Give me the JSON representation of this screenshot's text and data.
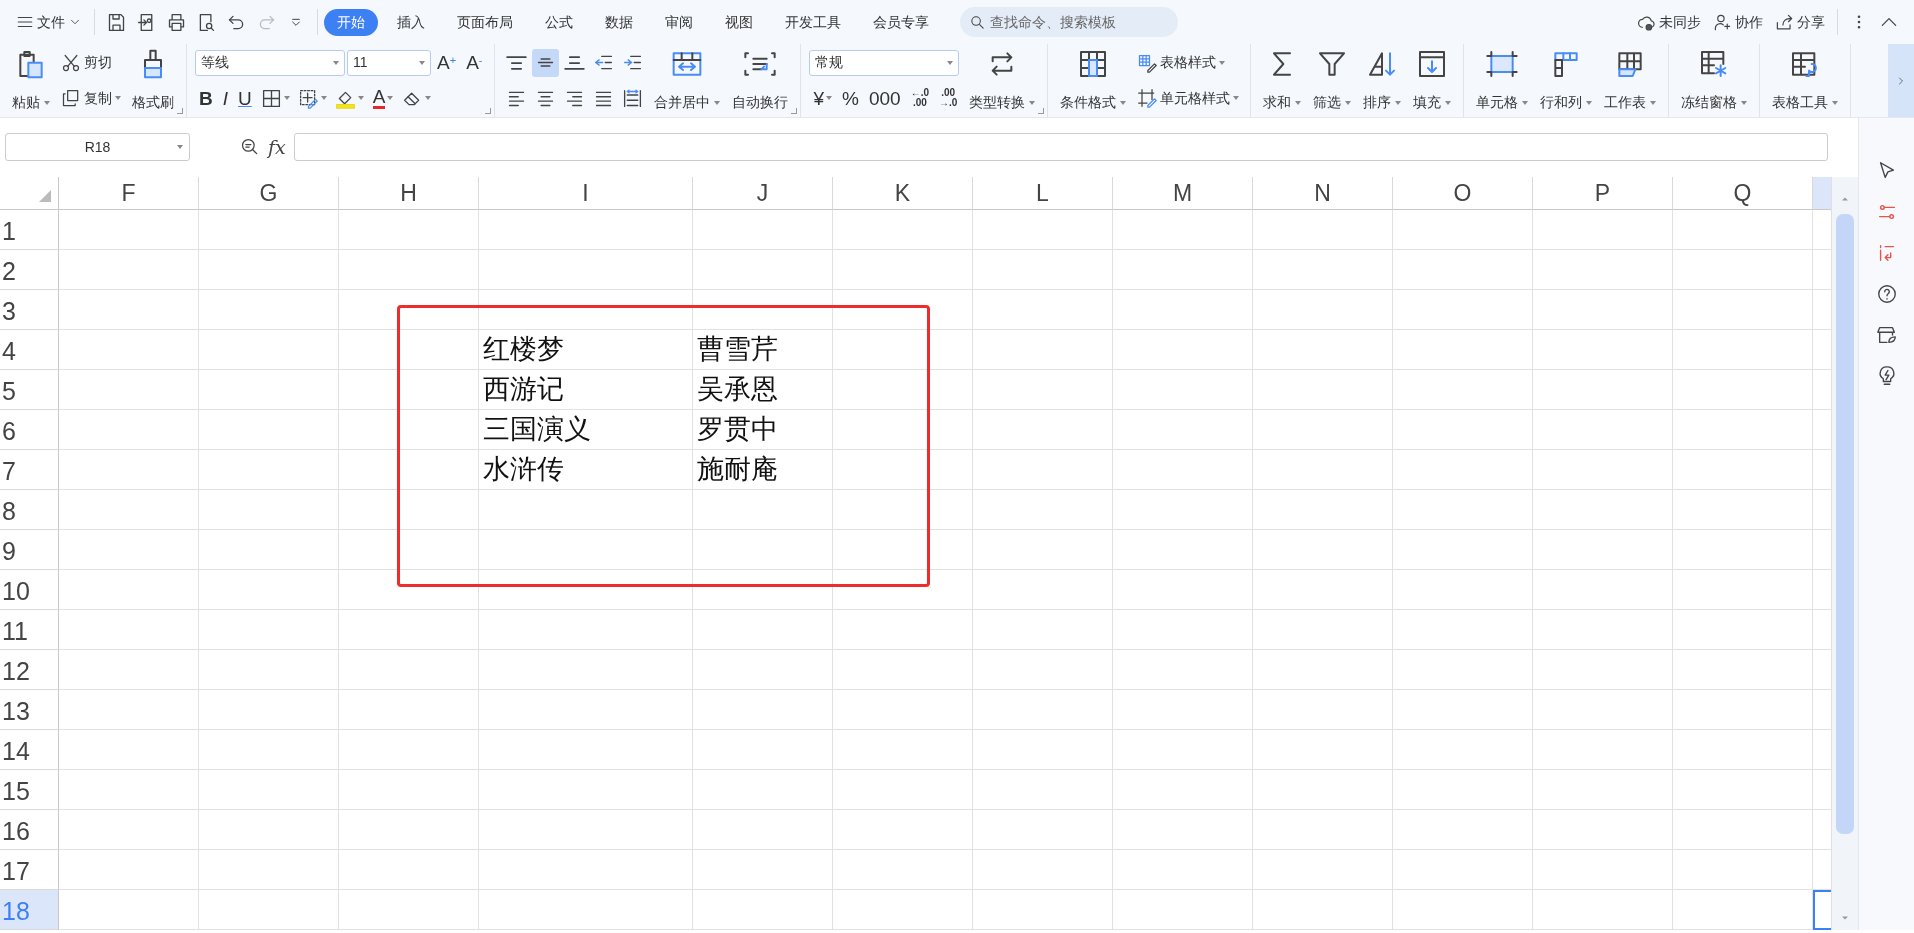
{
  "menu_bar": {
    "file_menu": "文件",
    "quick_access": [
      {
        "disabled": false
      },
      {
        "disabled": false
      },
      {
        "disabled": false
      },
      {
        "disabled": false
      },
      {
        "disabled": false
      },
      {
        "disabled": true
      },
      {
        "disabled": false
      }
    ],
    "tabs": [
      {
        "label": "开始",
        "selected": true
      },
      {
        "label": "插入",
        "selected": false
      },
      {
        "label": "页面布局",
        "selected": false
      },
      {
        "label": "公式",
        "selected": false
      },
      {
        "label": "数据",
        "selected": false
      },
      {
        "label": "审阅",
        "selected": false
      },
      {
        "label": "视图",
        "selected": false
      },
      {
        "label": "开发工具",
        "selected": false
      },
      {
        "label": "会员专享",
        "selected": false
      }
    ],
    "search": {
      "placeholder": "查找命令、搜索模板"
    },
    "actions": [
      "未同步",
      "协作",
      "分享"
    ]
  },
  "ribbon": {
    "groups": [
      {
        "launcher": true,
        "blocks": [
          {
            "kind": "large",
            "label": "粘贴",
            "dropdown": true
          },
          {
            "kind": "stack",
            "top": [
              {
                "kind": "small",
                "label": "剪切",
                "dropdown": false
              }
            ],
            "bottom": [
              {
                "kind": "small",
                "label": "复制",
                "dropdown": true
              }
            ]
          },
          {
            "kind": "large",
            "label": "格式刷",
            "dropdown": false
          }
        ]
      },
      {
        "launcher": true,
        "blocks": [
          {
            "kind": "stack",
            "top": [
              {
                "kind": "select",
                "value": "等线",
                "wide": true
              },
              {
                "kind": "select",
                "value": "11",
                "wide": false
              },
              {
                "kind": "glyph",
                "text": "A$^{+}$",
                "dropdown": false
              },
              {
                "kind": "glyph",
                "text": "A$^{-}$",
                "dropdown": false
              }
            ],
            "bottom": [
              {
                "kind": "glyph",
                "text": "B",
                "dropdown": false
              },
              {
                "kind": "glyph",
                "text": "I",
                "dropdown": false
              },
              {
                "kind": "glyph",
                "text": "U",
                "dropdown": false
              },
              {
                "kind": "icon",
                "dropdown": true,
                "on": false
              },
              {
                "kind": "icon",
                "dropdown": true,
                "on": false
              },
              {
                "kind": "icon",
                "dropdown": true,
                "on": false
              },
              {
                "kind": "glyph",
                "text": "A",
                "dropdown": true
              },
              {
                "kind": "icon",
                "dropdown": true,
                "on": false
              }
            ]
          }
        ]
      },
      {
        "launcher": true,
        "blocks": [
          {
            "kind": "stack",
            "top": [
              {
                "kind": "icon",
                "dropdown": false,
                "on": false
              },
              {
                "kind": "icon",
                "dropdown": false,
                "on": true
              },
              {
                "kind": "icon",
                "dropdown": false,
                "on": false
              },
              {
                "kind": "icon",
                "dropdown": false,
                "on": false
              },
              {
                "kind": "icon",
                "dropdown": false,
                "on": false
              }
            ],
            "bottom": [
              {
                "kind": "icon",
                "dropdown": false,
                "on": false
              },
              {
                "kind": "icon",
                "dropdown": false,
                "on": false
              },
              {
                "kind": "icon",
                "dropdown": false,
                "on": false
              },
              {
                "kind": "icon",
                "dropdown": false,
                "on": false
              },
              {
                "kind": "icon",
                "dropdown": false,
                "on": false
              }
            ]
          },
          {
            "kind": "large",
            "label": "合并居中",
            "dropdown": true
          },
          {
            "kind": "large",
            "label": "自动换行",
            "dropdown": false
          }
        ]
      },
      {
        "launcher": true,
        "blocks": [
          {
            "kind": "stack",
            "top": [
              {
                "kind": "select",
                "value": "常规",
                "wide": true
              }
            ],
            "bottom": [
              {
                "kind": "glyph",
                "text": "¥",
                "dropdown": true
              },
              {
                "kind": "glyph",
                "text": "%",
                "dropdown": false
              },
              {
                "kind": "glyph",
                "text": "000",
                "dropdown": false
              },
              {
                "kind": "glyph",
                "text": "←.0 .00",
                "dropdown": false
              },
              {
                "kind": "glyph",
                "text": ".00 →.0",
                "dropdown": false
              }
            ]
          },
          {
            "kind": "large",
            "label": "类型转换",
            "dropdown": true
          }
        ]
      },
      {
        "launcher": false,
        "blocks": [
          {
            "kind": "large",
            "label": "条件格式",
            "dropdown": true
          },
          {
            "kind": "stack",
            "top": [
              {
                "kind": "small",
                "label": "表格样式",
                "dropdown": true
              }
            ],
            "bottom": [
              {
                "kind": "small",
                "label": "单元格样式",
                "dropdown": true
              }
            ]
          }
        ]
      },
      {
        "launcher": false,
        "blocks": [
          {
            "kind": "large",
            "label": "求和",
            "dropdown": true
          },
          {
            "kind": "large",
            "label": "筛选",
            "dropdown": true
          },
          {
            "kind": "large",
            "label": "排序",
            "dropdown": true
          },
          {
            "kind": "large",
            "label": "填充",
            "dropdown": true
          }
        ]
      },
      {
        "launcher": false,
        "blocks": [
          {
            "kind": "large",
            "label": "单元格",
            "dropdown": true
          },
          {
            "kind": "large",
            "label": "行和列",
            "dropdown": true
          },
          {
            "kind": "large",
            "label": "工作表",
            "dropdown": true
          }
        ]
      },
      {
        "launcher": false,
        "blocks": [
          {
            "kind": "large",
            "label": "冻结窗格",
            "dropdown": true
          }
        ]
      },
      {
        "launcher": false,
        "blocks": [
          {
            "kind": "large",
            "label": "表格工具",
            "dropdown": true
          }
        ]
      }
    ]
  },
  "formula_bar": {
    "name_box": "R18",
    "function_label": "fx"
  },
  "sheet": {
    "columns": [
      "F",
      "G",
      "H",
      "I",
      "J",
      "K",
      "L",
      "M",
      "N",
      "O",
      "P",
      "Q"
    ],
    "partial_column": {
      "selected": true
    },
    "rows": [
      {
        "header": "1",
        "selected": false
      },
      {
        "header": "2",
        "selected": false
      },
      {
        "header": "3",
        "selected": false
      },
      {
        "header": "4",
        "selected": false,
        "I": "红楼梦",
        "J": "曹雪芹"
      },
      {
        "header": "5",
        "selected": false,
        "I": "西游记",
        "J": "吴承恩"
      },
      {
        "header": "6",
        "selected": false,
        "I": "三国演义",
        "J": "罗贯中"
      },
      {
        "header": "7",
        "selected": false,
        "I": "水浒传",
        "J": "施耐庵"
      },
      {
        "header": "8",
        "selected": false
      },
      {
        "header": "9",
        "selected": false
      },
      {
        "header": "10",
        "selected": false
      },
      {
        "header": "11",
        "selected": false
      },
      {
        "header": "12",
        "selected": false
      },
      {
        "header": "13",
        "selected": false
      },
      {
        "header": "14",
        "selected": false
      },
      {
        "header": "15",
        "selected": false
      },
      {
        "header": "16",
        "selected": false
      },
      {
        "header": "17",
        "selected": false
      },
      {
        "header": "18",
        "selected": true
      }
    ],
    "annotation": {
      "kind": "rectangle"
    }
  }
}
